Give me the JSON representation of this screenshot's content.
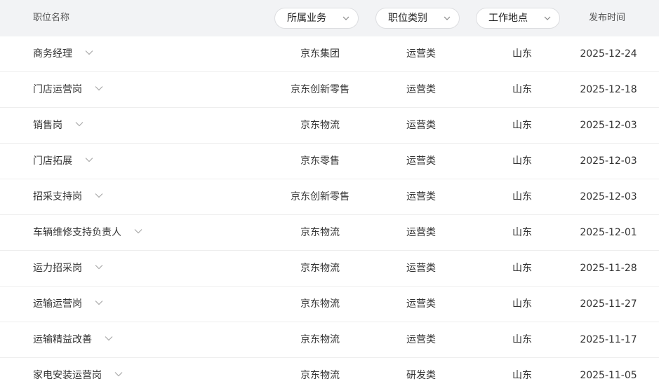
{
  "header": {
    "name_label": "职位名称",
    "filters": [
      {
        "label": "所属业务"
      },
      {
        "label": "职位类别"
      },
      {
        "label": "工作地点"
      }
    ],
    "date_label": "发布时间"
  },
  "rows": [
    {
      "title": "商务经理",
      "business": "京东集团",
      "category": "运营类",
      "location": "山东",
      "date": "2025-12-24"
    },
    {
      "title": "门店运营岗",
      "business": "京东创新零售",
      "category": "运营类",
      "location": "山东",
      "date": "2025-12-18"
    },
    {
      "title": "销售岗",
      "business": "京东物流",
      "category": "运营类",
      "location": "山东",
      "date": "2025-12-03"
    },
    {
      "title": "门店拓展",
      "business": "京东零售",
      "category": "运营类",
      "location": "山东",
      "date": "2025-12-03"
    },
    {
      "title": "招采支持岗",
      "business": "京东创新零售",
      "category": "运营类",
      "location": "山东",
      "date": "2025-12-03"
    },
    {
      "title": "车辆维修支持负责人",
      "business": "京东物流",
      "category": "运营类",
      "location": "山东",
      "date": "2025-12-01"
    },
    {
      "title": "运力招采岗",
      "business": "京东物流",
      "category": "运营类",
      "location": "山东",
      "date": "2025-11-28"
    },
    {
      "title": "运输运营岗",
      "business": "京东物流",
      "category": "运营类",
      "location": "山东",
      "date": "2025-11-27"
    },
    {
      "title": "运输精益改善",
      "business": "京东物流",
      "category": "运营类",
      "location": "山东",
      "date": "2025-11-17"
    },
    {
      "title": "家电安装运营岗",
      "business": "京东物流",
      "category": "研发类",
      "location": "山东",
      "date": "2025-11-05"
    }
  ],
  "icons": {
    "filter_dropdown": "chevron-down-icon",
    "row_expand": "chevron-down-icon"
  },
  "colors": {
    "header_bg": "#f2f3f5",
    "text": "#333333",
    "divider": "#eeeeee"
  }
}
